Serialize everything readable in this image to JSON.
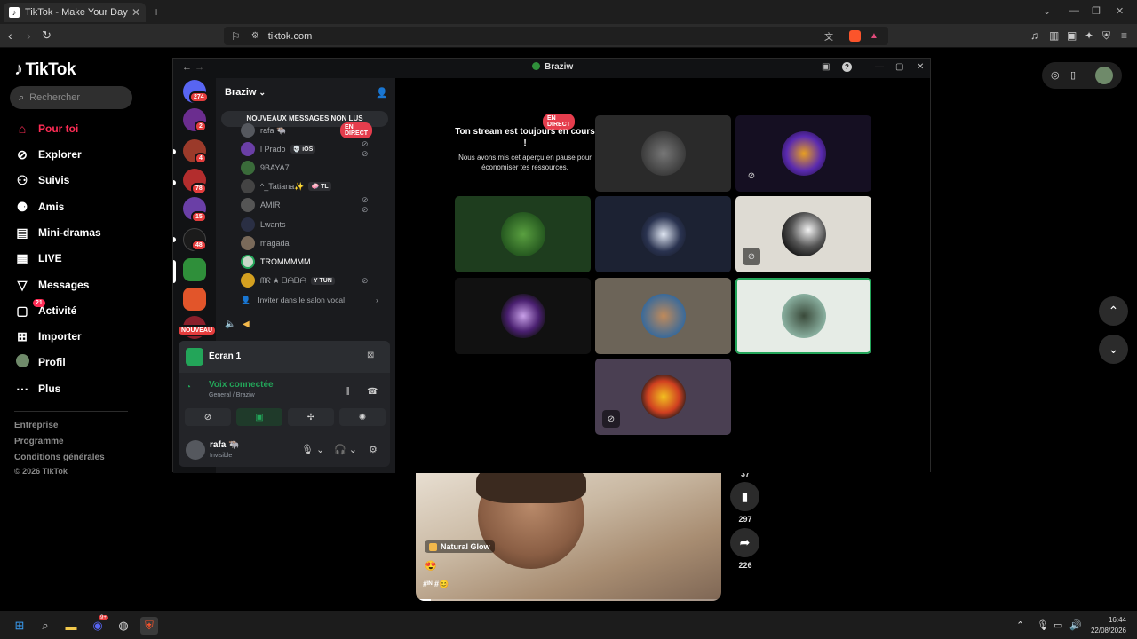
{
  "browser": {
    "tab_title": "TikTok - Make Your Day",
    "url": "tiktok.com"
  },
  "tiktok": {
    "brand": "TikTok",
    "search_placeholder": "Rechercher",
    "nav": [
      {
        "label": "Pour toi",
        "icon": "home-icon"
      },
      {
        "label": "Explorer",
        "icon": "compass-icon"
      },
      {
        "label": "Suivis",
        "icon": "user-follow-icon"
      },
      {
        "label": "Amis",
        "icon": "friends-icon"
      },
      {
        "label": "Mini-dramas",
        "icon": "film-icon"
      },
      {
        "label": "LIVE",
        "icon": "live-tv-icon"
      },
      {
        "label": "Messages",
        "icon": "send-icon"
      },
      {
        "label": "Activité",
        "icon": "inbox-icon",
        "badge": "21"
      },
      {
        "label": "Importer",
        "icon": "plus-square-icon"
      },
      {
        "label": "Profil",
        "icon": "profile-avatar-icon"
      },
      {
        "label": "Plus",
        "icon": "more-dots-icon"
      }
    ],
    "footer": [
      "Entreprise",
      "Programme",
      "Conditions générales",
      "© 2026 TikTok"
    ],
    "video": {
      "effect_tag": "Natural Glow",
      "hashtag": "#‍1‍N #",
      "progress": 0.05,
      "counts": {
        "partial": "37",
        "saves": "297",
        "shares": "226"
      }
    }
  },
  "discord": {
    "window_title": "Braziw",
    "server_name": "Braziw",
    "unread_banner": "NOUVEAUX MESSAGES NON LUS",
    "guild_badges": [
      "274",
      "2",
      "4",
      "78",
      "15",
      "48",
      "NOUVEAU"
    ],
    "voice_users": [
      {
        "name": "rafa 🐃",
        "live": "EN DIRECT"
      },
      {
        "name": "l Prado",
        "tag": "💀 iOS",
        "muted": true
      },
      {
        "name": "9BAYA7"
      },
      {
        "name": "^_Tatiana✨",
        "tag": "🧼 TL"
      },
      {
        "name": "AMIR",
        "muted": true
      },
      {
        "name": "Lwants"
      },
      {
        "name": "magada"
      },
      {
        "name": "TROMMMMM",
        "bright": true
      },
      {
        "name": "ᗰᖇ ★ ᗷᗩᗷᗩ",
        "tag": "Y TUN",
        "muted": true
      }
    ],
    "invite_label": "Inviter dans le salon vocal",
    "screen_label": "Écran 1",
    "voice_status": "Voix connectée",
    "voice_channel": "General / Braziw",
    "user_name": "rafa 🐃",
    "user_status": "Invisible",
    "stream_live": "EN DIRECT",
    "stream_heading": "Ton stream est toujours en cours !",
    "stream_text": "Nous avons mis cet aperçu en pause pour économiser tes ressources."
  },
  "taskbar": {
    "discord_badge": "9+",
    "time": "16:44",
    "date": "22/08/2026"
  },
  "colors": {
    "tiktok_accent": "#fe2c55",
    "discord_green": "#23a559",
    "live_red": "#e53d4d"
  }
}
